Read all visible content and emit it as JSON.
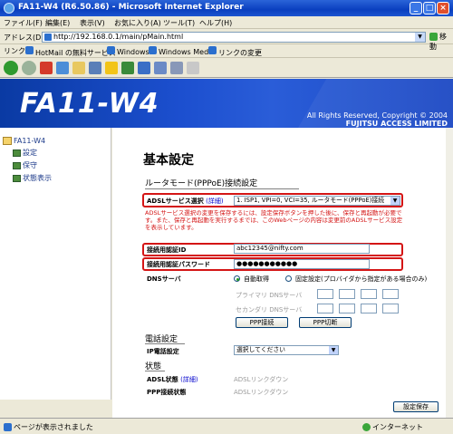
{
  "window": {
    "title": "FA11-W4 (R6.50.86) - Microsoft Internet Explorer"
  },
  "menu": [
    "ファイル(F)",
    "編集(E)",
    "表示(V)",
    "お気に入り(A)",
    "ツール(T)",
    "ヘルプ(H)"
  ],
  "address": {
    "label": "アドレス(D)",
    "url": "http://192.168.0.1/main/pMain.html",
    "go_label": "移動"
  },
  "links": {
    "label": "リンク",
    "items": [
      "HotMail の無料サービス",
      "Windows",
      "Windows Media",
      "リンクの変更"
    ]
  },
  "banner": {
    "logo": "FA11-W4",
    "copyright1": "All Rights Reserved, Copyright © 2004",
    "copyright2": "FUJITSU ACCESS LIMITED"
  },
  "sidebar": {
    "root": "FA11-W4",
    "items": [
      "設定",
      "保守",
      "状態表示"
    ]
  },
  "page": {
    "title": "基本設定",
    "router_section": "ルータモード(PPPoE)接続設定",
    "adsl_service_label": "ADSLサービス選択",
    "detail_link": "(詳細)",
    "adsl_service_value": "1. ISP1, VPI=0, VCI=35, ルータモード(PPPoE)接続",
    "note": "ADSLサービス選択の変更を保存するには、設定保存ボタンを押した後に、保存と再起動が必要です。また、保存と再起動を実行するまでは、このWebページの内容は変更前のADSLサービス設定を表示しています。",
    "auth_id_label": "接続用認証ID",
    "auth_id_value": "abc12345@nifty.com",
    "auth_pw_label": "接続用認証パスワード",
    "auth_pw_value": "●●●●●●●●●●●",
    "dns_label": "DNSサーバ",
    "dns_auto": "自動取得",
    "dns_fixed": "固定設定(プロバイダから指定がある場合のみ)",
    "dns_primary": "プライマリ DNSサーバ",
    "dns_secondary": "セカンダリ DNSサーバ",
    "ppp_connect": "PPP接続",
    "ppp_disconnect": "PPP切断",
    "phone_section": "電話設定",
    "ip_phone_label": "IP電話設定",
    "ip_phone_value": "選択してください",
    "status_section": "状態",
    "adsl_status_label": "ADSL状態",
    "adsl_status_value": "ADSLリンクダウン",
    "ppp_status_label": "PPP接続状態",
    "ppp_status_value": "ADSLリンクダウン",
    "save_button": "設定保存"
  },
  "status": {
    "left": "ページが表示されました",
    "zone": "インターネット"
  }
}
